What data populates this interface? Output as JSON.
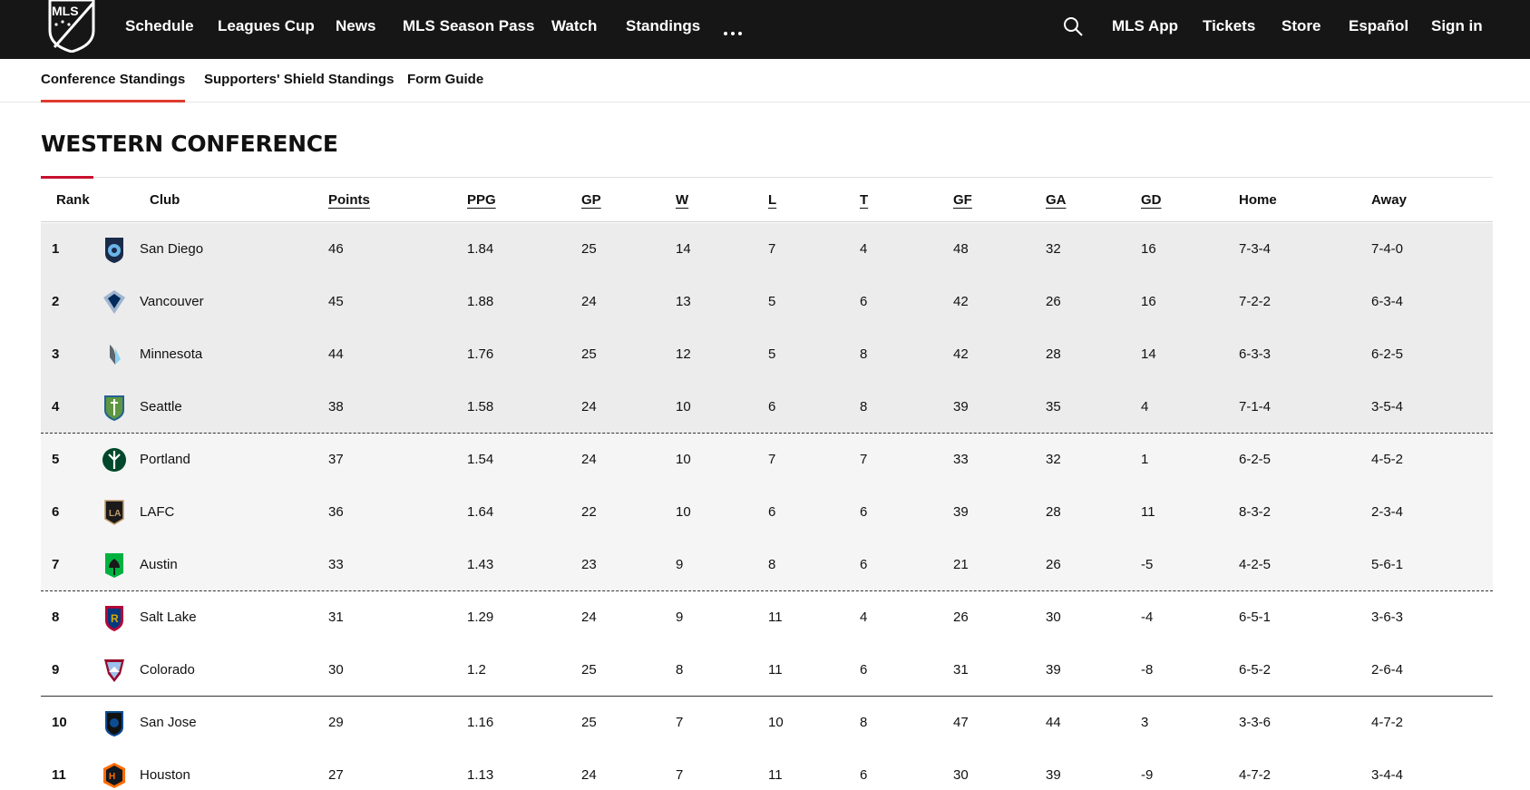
{
  "nav": {
    "logo_text": "MLS",
    "items": [
      "Schedule",
      "Leagues Cup",
      "News",
      "MLS Season Pass",
      "Watch",
      "Standings"
    ],
    "more_icon": "more-dots-icon",
    "search_icon": "search-icon",
    "right_items": [
      "MLS App",
      "Tickets",
      "Store",
      "Español",
      "Sign in"
    ]
  },
  "subnav": {
    "tabs": [
      "Conference Standings",
      "Supporters' Shield Standings",
      "Form Guide"
    ],
    "active": "Conference Standings"
  },
  "conference": {
    "title": "WESTERN CONFERENCE",
    "accent_color": "#c8102e"
  },
  "table": {
    "headers": [
      "Rank",
      "Club",
      "Points",
      "PPG",
      "GP",
      "W",
      "L",
      "T",
      "GF",
      "GA",
      "GD",
      "Home",
      "Away"
    ],
    "rows": [
      {
        "rank": "1",
        "club": "San Diego",
        "crest": "san-diego-crest-icon",
        "pts": "46",
        "ppg": "1.84",
        "gp": "25",
        "w": "14",
        "l": "7",
        "t": "4",
        "gf": "48",
        "ga": "32",
        "gd": "16",
        "home": "7-3-4",
        "away": "7-4-0"
      },
      {
        "rank": "2",
        "club": "Vancouver",
        "crest": "vancouver-crest-icon",
        "pts": "45",
        "ppg": "1.88",
        "gp": "24",
        "w": "13",
        "l": "5",
        "t": "6",
        "gf": "42",
        "ga": "26",
        "gd": "16",
        "home": "7-2-2",
        "away": "6-3-4"
      },
      {
        "rank": "3",
        "club": "Minnesota",
        "crest": "minnesota-crest-icon",
        "pts": "44",
        "ppg": "1.76",
        "gp": "25",
        "w": "12",
        "l": "5",
        "t": "8",
        "gf": "42",
        "ga": "28",
        "gd": "14",
        "home": "6-3-3",
        "away": "6-2-5"
      },
      {
        "rank": "4",
        "club": "Seattle",
        "crest": "seattle-crest-icon",
        "pts": "38",
        "ppg": "1.58",
        "gp": "24",
        "w": "10",
        "l": "6",
        "t": "8",
        "gf": "39",
        "ga": "35",
        "gd": "4",
        "home": "7-1-4",
        "away": "3-5-4"
      },
      {
        "rank": "5",
        "club": "Portland",
        "crest": "portland-crest-icon",
        "pts": "37",
        "ppg": "1.54",
        "gp": "24",
        "w": "10",
        "l": "7",
        "t": "7",
        "gf": "33",
        "ga": "32",
        "gd": "1",
        "home": "6-2-5",
        "away": "4-5-2"
      },
      {
        "rank": "6",
        "club": "LAFC",
        "crest": "lafc-crest-icon",
        "pts": "36",
        "ppg": "1.64",
        "gp": "22",
        "w": "10",
        "l": "6",
        "t": "6",
        "gf": "39",
        "ga": "28",
        "gd": "11",
        "home": "8-3-2",
        "away": "2-3-4"
      },
      {
        "rank": "7",
        "club": "Austin",
        "crest": "austin-crest-icon",
        "pts": "33",
        "ppg": "1.43",
        "gp": "23",
        "w": "9",
        "l": "8",
        "t": "6",
        "gf": "21",
        "ga": "26",
        "gd": "-5",
        "home": "4-2-5",
        "away": "5-6-1"
      },
      {
        "rank": "8",
        "club": "Salt Lake",
        "crest": "salt-lake-crest-icon",
        "pts": "31",
        "ppg": "1.29",
        "gp": "24",
        "w": "9",
        "l": "11",
        "t": "4",
        "gf": "26",
        "ga": "30",
        "gd": "-4",
        "home": "6-5-1",
        "away": "3-6-3"
      },
      {
        "rank": "9",
        "club": "Colorado",
        "crest": "colorado-crest-icon",
        "pts": "30",
        "ppg": "1.2",
        "gp": "25",
        "w": "8",
        "l": "11",
        "t": "6",
        "gf": "31",
        "ga": "39",
        "gd": "-8",
        "home": "6-5-2",
        "away": "2-6-4"
      },
      {
        "rank": "10",
        "club": "San Jose",
        "crest": "san-jose-crest-icon",
        "pts": "29",
        "ppg": "1.16",
        "gp": "25",
        "w": "7",
        "l": "10",
        "t": "8",
        "gf": "47",
        "ga": "44",
        "gd": "3",
        "home": "3-3-6",
        "away": "4-7-2"
      },
      {
        "rank": "11",
        "club": "Houston",
        "crest": "houston-crest-icon",
        "pts": "27",
        "ppg": "1.13",
        "gp": "24",
        "w": "7",
        "l": "11",
        "t": "6",
        "gf": "30",
        "ga": "39",
        "gd": "-9",
        "home": "4-7-2",
        "away": "3-4-4"
      }
    ]
  }
}
